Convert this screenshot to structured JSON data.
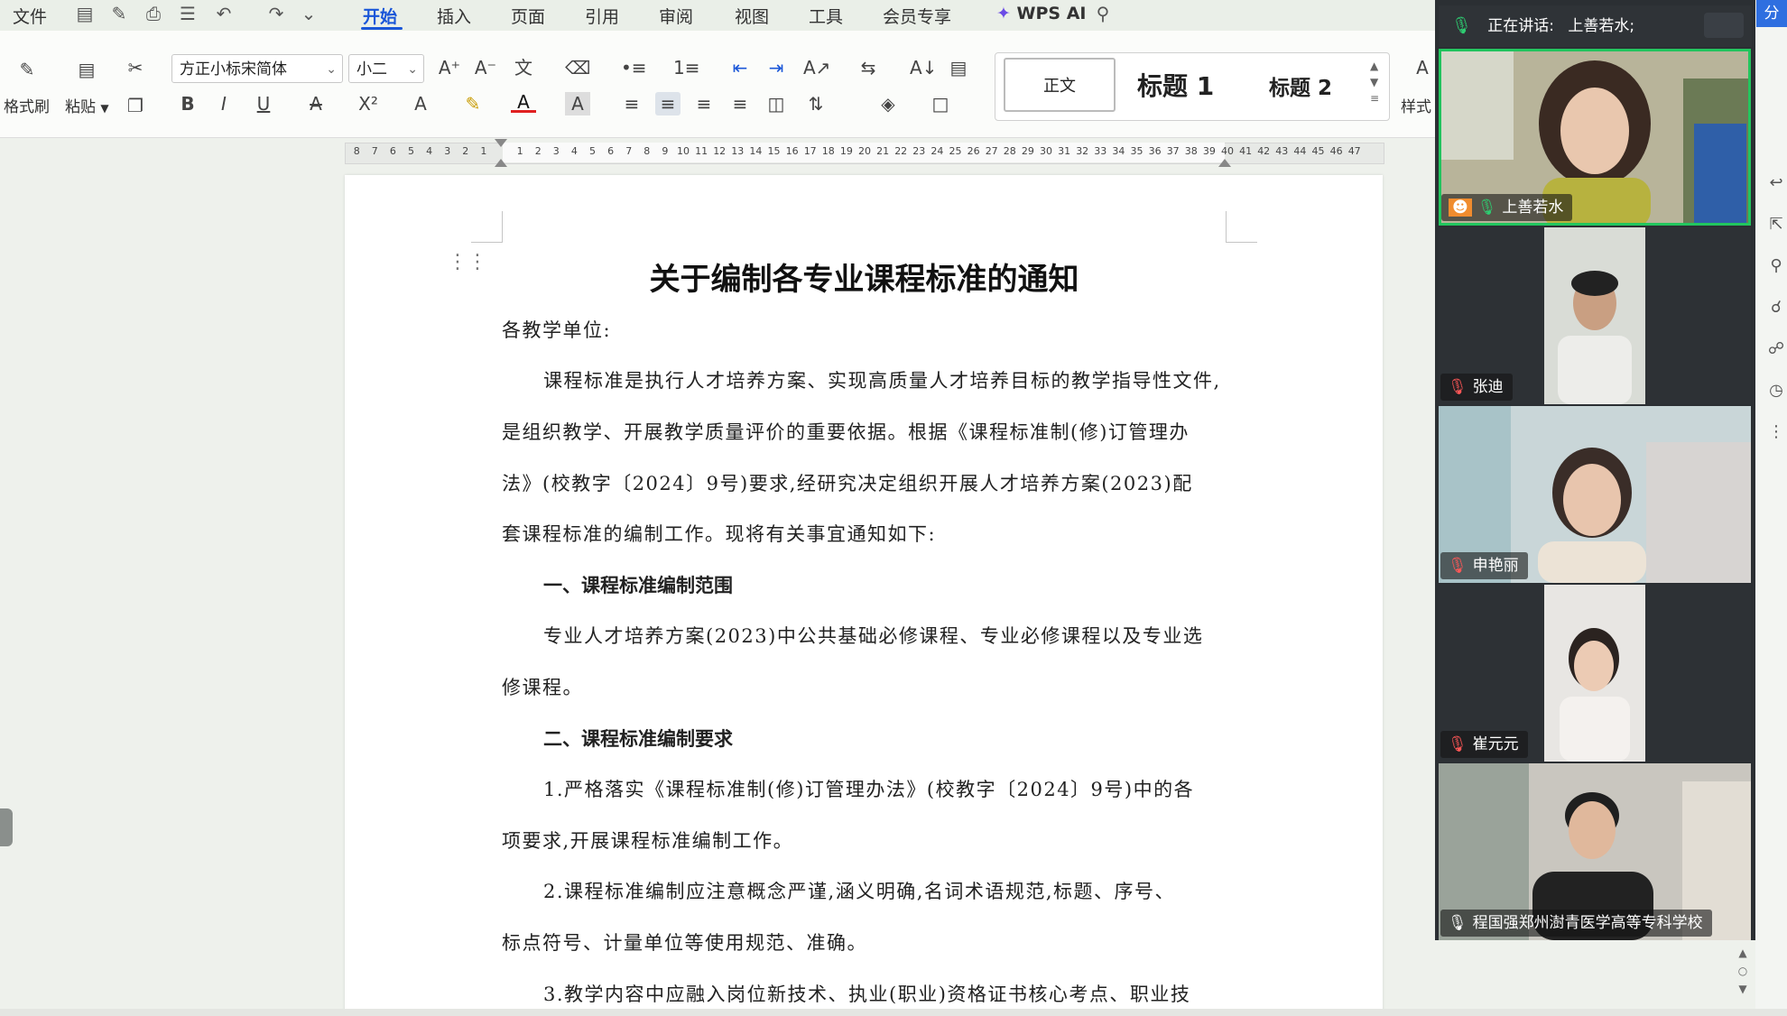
{
  "menubar": {
    "file": "文件",
    "tabs": [
      "开始",
      "插入",
      "页面",
      "引用",
      "审阅",
      "视图",
      "工具",
      "会员专享"
    ],
    "wps_ai": "WPS AI"
  },
  "ribbon": {
    "format_painter": "格式刷",
    "paste": "粘贴",
    "font_name": "方正小标宋简体",
    "font_size": "小二",
    "styles": {
      "normal": "正文",
      "heading1": "标题 1",
      "heading2": "标题 2",
      "more": "样式"
    }
  },
  "ruler": {
    "left": [
      "8",
      "7",
      "6",
      "5",
      "4",
      "3",
      "2",
      "1"
    ],
    "right": [
      "1",
      "2",
      "3",
      "4",
      "5",
      "6",
      "7",
      "8",
      "9",
      "10",
      "11",
      "12",
      "13",
      "14",
      "15",
      "16",
      "17",
      "18",
      "19",
      "20",
      "21",
      "22",
      "23",
      "24",
      "25",
      "26",
      "27",
      "28",
      "29",
      "30",
      "31",
      "32",
      "33",
      "34",
      "35",
      "36",
      "37",
      "38",
      "39",
      "40",
      "41",
      "42",
      "43",
      "44",
      "45",
      "46",
      "47"
    ]
  },
  "document": {
    "title": "关于编制各专业课程标准的通知",
    "salutation": "各教学单位:",
    "p1": [
      "课程标准是执行人才培养方案、实现高质量人才培养目标的教学指导性文件,",
      "是组织教学、开展教学质量评价的重要依据。根据《课程标准制(修)订管理办",
      "法》(校教字〔2024〕9号)要求,经研究决定组织开展人才培养方案(2023)配",
      "套课程标准的编制工作。现将有关事宜通知如下:"
    ],
    "h1": "一、课程标准编制范围",
    "p2": [
      "专业人才培养方案(2023)中公共基础必修课程、专业必修课程以及专业选",
      "修课程。"
    ],
    "h2": "二、课程标准编制要求",
    "p3": [
      "1.严格落实《课程标准制(修)订管理办法》(校教字〔2024〕9号)中的各",
      "项要求,开展课程标准编制工作。"
    ],
    "p4": [
      "2.课程标准编制应注意概念严谨,涵义明确,名词术语规范,标题、序号、",
      "标点符号、计量单位等使用规范、准确。"
    ],
    "p5": [
      "3.教学内容中应融入岗位新技术、执业(职业)资格证书核心考点、职业技"
    ]
  },
  "meeting": {
    "speaking_label": "正在讲话:",
    "speaking_name": "上善若水;",
    "participants": [
      {
        "name": "上善若水",
        "mic": "on",
        "active": true
      },
      {
        "name": "张迪",
        "mic": "muted"
      },
      {
        "name": "申艳丽",
        "mic": "muted"
      },
      {
        "name": "崔元元",
        "mic": "muted"
      },
      {
        "name": "程国强郑州澍青医学高等专科学校",
        "mic": "on"
      }
    ]
  },
  "right_strip": {
    "share": "分"
  },
  "colors": {
    "accent": "#1a56d8",
    "active_border": "#22c55e",
    "panel_bg": "#2b2f33"
  }
}
